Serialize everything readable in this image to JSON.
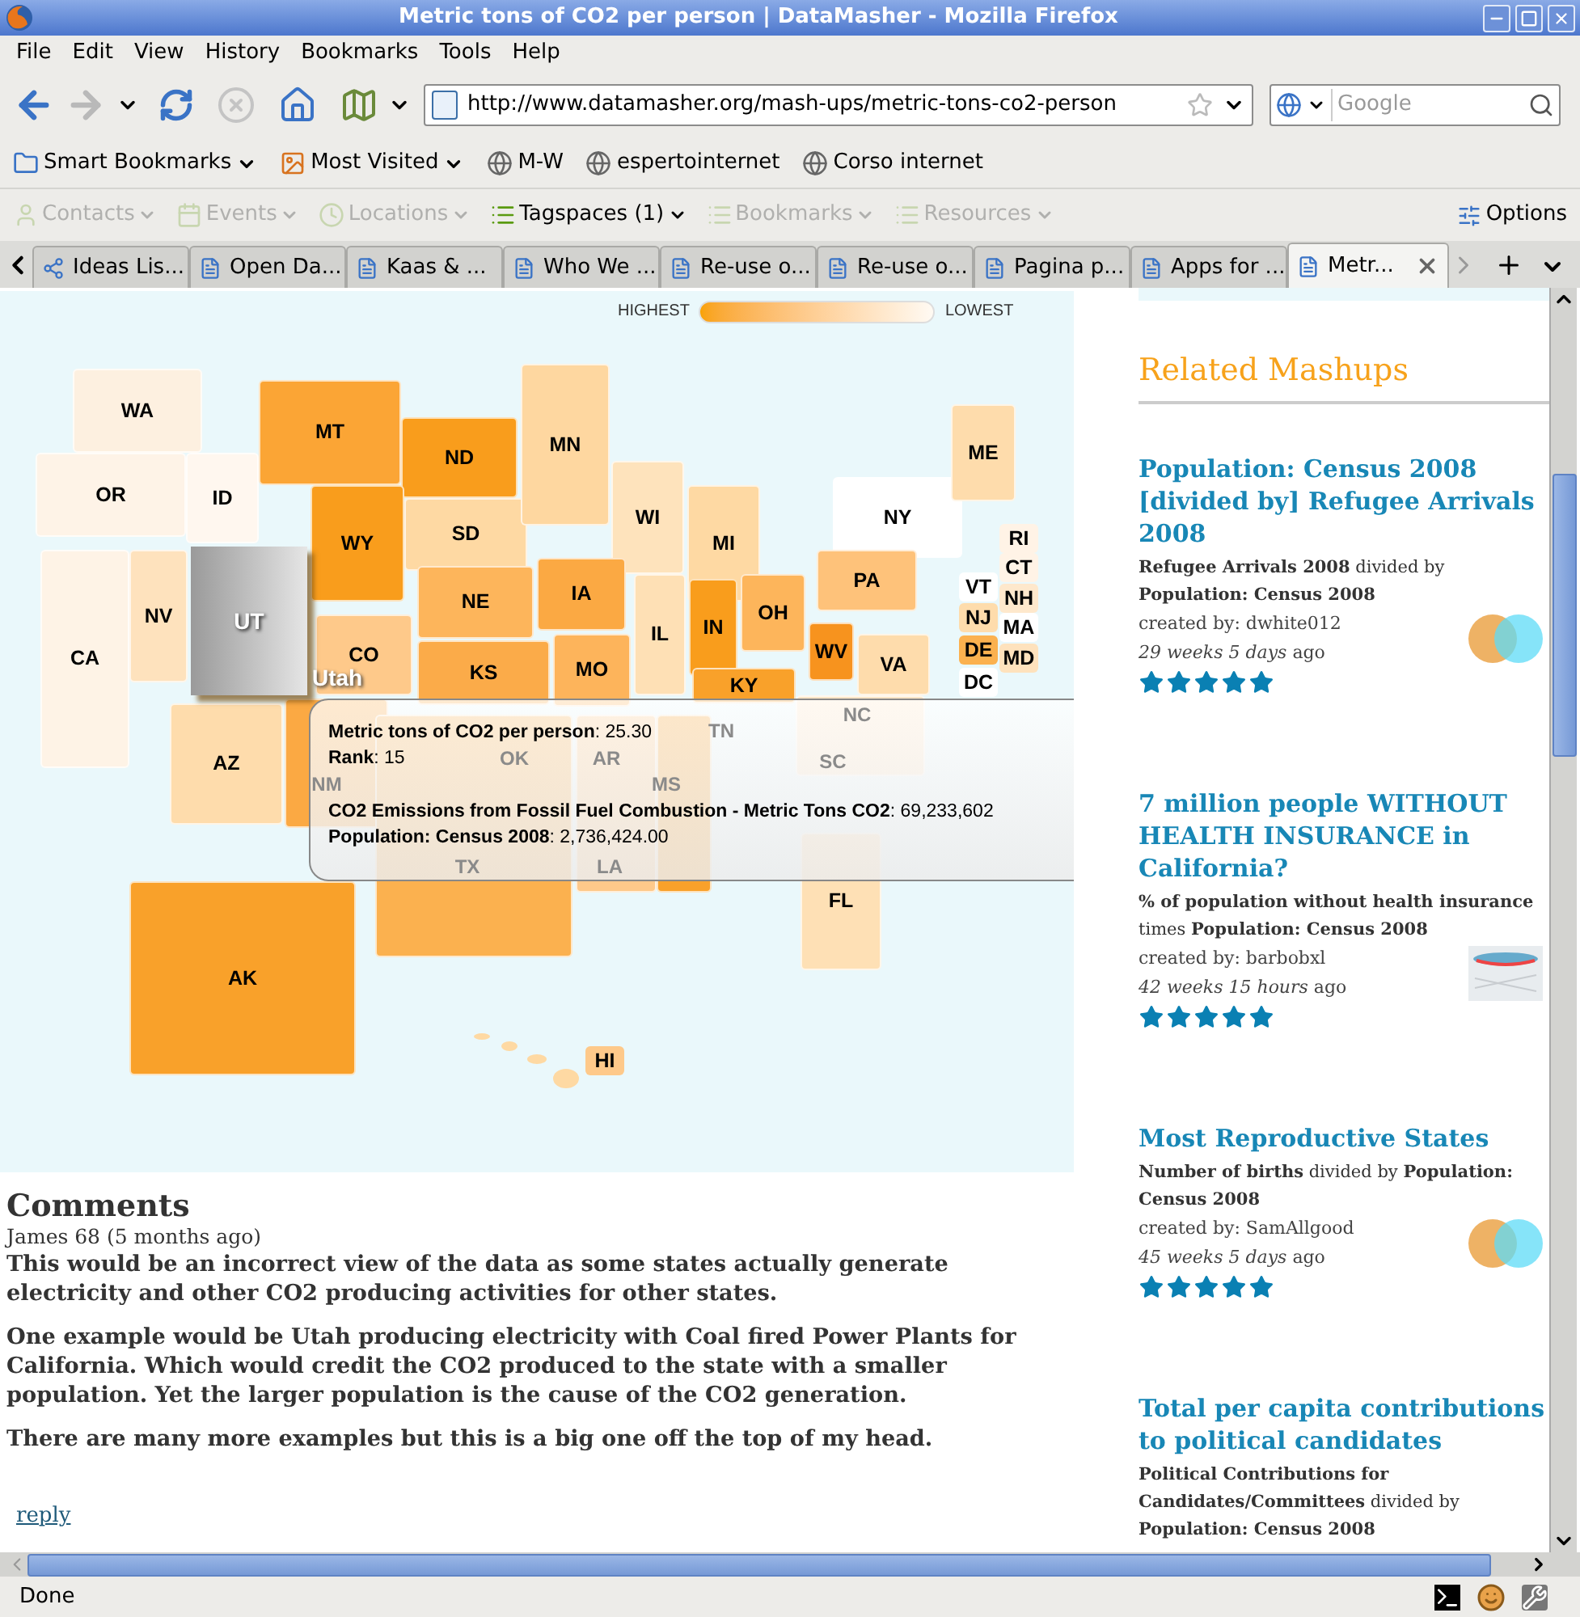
{
  "window": {
    "title": "Metric tons of CO2 per person | DataMasher - Mozilla Firefox"
  },
  "menu": [
    "File",
    "Edit",
    "View",
    "History",
    "Bookmarks",
    "Tools",
    "Help"
  ],
  "address_bar": {
    "url": "http://www.datamasher.org/mash-ups/metric-tons-co2-person"
  },
  "search": {
    "placeholder": "Google"
  },
  "bookmarks": [
    {
      "label": "Smart Bookmarks",
      "kind": "folder"
    },
    {
      "label": "Most Visited",
      "kind": "folder"
    },
    {
      "label": "M-W",
      "kind": "link"
    },
    {
      "label": "espertointernet",
      "kind": "link"
    },
    {
      "label": "Corso internet",
      "kind": "link"
    }
  ],
  "tag_toolbar": {
    "items": [
      {
        "label": "Contacts",
        "disabled": true
      },
      {
        "label": "Events",
        "disabled": true
      },
      {
        "label": "Locations",
        "disabled": true
      },
      {
        "label": "Tagspaces (1)",
        "disabled": false
      },
      {
        "label": "Bookmarks",
        "disabled": true
      },
      {
        "label": "Resources",
        "disabled": true
      }
    ],
    "options": "Options"
  },
  "tabs": [
    {
      "label": "Ideas Lis...",
      "selected": false
    },
    {
      "label": "Open Da...",
      "selected": false
    },
    {
      "label": "Kaas & ...",
      "selected": false
    },
    {
      "label": "Who We ...",
      "selected": false
    },
    {
      "label": "Re-use o...",
      "selected": false
    },
    {
      "label": "Re-use o...",
      "selected": false
    },
    {
      "label": "Pagina p...",
      "selected": false
    },
    {
      "label": "Apps for ...",
      "selected": false
    },
    {
      "label": "Metr...",
      "selected": true
    }
  ],
  "map": {
    "legend": {
      "high": "HIGHEST",
      "low": "LOWEST"
    },
    "states": [
      {
        "label": "WA",
        "color": "#fdf0e0",
        "kind": "region",
        "selected": false
      },
      {
        "label": "OR",
        "color": "#fef3e7",
        "kind": "region",
        "selected": false
      },
      {
        "label": "ID",
        "color": "#fff7ef",
        "kind": "region",
        "selected": false
      },
      {
        "label": "MT",
        "color": "#fba535",
        "kind": "region",
        "selected": false
      },
      {
        "label": "ND",
        "color": "#f99d1c",
        "kind": "region",
        "selected": false
      },
      {
        "label": "WY",
        "color": "#f99d1c",
        "kind": "region",
        "selected": false
      },
      {
        "label": "SD",
        "color": "#fed9a3",
        "kind": "region",
        "selected": false
      },
      {
        "label": "MN",
        "color": "#fed7a0",
        "kind": "region",
        "selected": false
      },
      {
        "label": "WI",
        "color": "#fee3bc",
        "kind": "region",
        "selected": false
      },
      {
        "label": "MI",
        "color": "#fed9a3",
        "kind": "region",
        "selected": false
      },
      {
        "label": "NY",
        "color": "#ffffff",
        "kind": "region",
        "selected": false
      },
      {
        "label": "ME",
        "color": "#fedcac",
        "kind": "region",
        "selected": false
      },
      {
        "label": "CA",
        "color": "#fef3e6",
        "kind": "region",
        "selected": false
      },
      {
        "label": "NV",
        "color": "#fee2bd",
        "kind": "region",
        "selected": false
      },
      {
        "label": "UT",
        "kind": "region",
        "selected": true
      },
      {
        "label": "CO",
        "color": "#fec98a",
        "kind": "region",
        "selected": false
      },
      {
        "label": "NE",
        "color": "#fdb55b",
        "kind": "region",
        "selected": false
      },
      {
        "label": "IA",
        "color": "#fba943",
        "kind": "region",
        "selected": false
      },
      {
        "label": "IL",
        "color": "#fee0b5",
        "kind": "region",
        "selected": false
      },
      {
        "label": "IN",
        "color": "#f99d1c",
        "kind": "region",
        "selected": false
      },
      {
        "label": "OH",
        "color": "#fdb55b",
        "kind": "region",
        "selected": false
      },
      {
        "label": "PA",
        "color": "#fec27a",
        "kind": "region",
        "selected": false
      },
      {
        "label": "WV",
        "color": "#f7931e",
        "kind": "region",
        "selected": false
      },
      {
        "label": "VA",
        "color": "#fedcac",
        "kind": "region",
        "selected": false
      },
      {
        "label": "KS",
        "color": "#fbab49",
        "kind": "region",
        "selected": false
      },
      {
        "label": "MO",
        "color": "#fdb45b",
        "kind": "region",
        "selected": false
      },
      {
        "label": "KY",
        "color": "#f9a12a",
        "kind": "region",
        "selected": false
      },
      {
        "label": "AZ",
        "color": "#fedcac",
        "kind": "region",
        "selected": false
      },
      {
        "label": "NM",
        "color": "#fba943",
        "kind": "covered",
        "selected": false
      },
      {
        "label": "OK",
        "kind": "covered",
        "selected": false
      },
      {
        "label": "TX",
        "color": "#fbb14f",
        "kind": "covered",
        "selected": false
      },
      {
        "label": "AR",
        "kind": "covered",
        "selected": false
      },
      {
        "label": "TN",
        "kind": "covered",
        "selected": false
      },
      {
        "label": "NC",
        "color": "#fee6c8",
        "kind": "covered",
        "selected": false
      },
      {
        "label": "SC",
        "kind": "covered",
        "selected": false
      },
      {
        "label": "MS",
        "color": "#f9a12a",
        "kind": "covered",
        "selected": false
      },
      {
        "label": "LA",
        "color": "#fec98a",
        "kind": "covered",
        "selected": false
      },
      {
        "label": "FL",
        "color": "#fee0b5",
        "kind": "region",
        "selected": false
      },
      {
        "label": "AK",
        "color": "#f9a12a",
        "kind": "region",
        "selected": false
      },
      {
        "label": "HI",
        "color": "#fec98a",
        "kind": "chip",
        "selected": false
      },
      {
        "label": "RI",
        "color": "#fff3e6",
        "kind": "chip",
        "selected": false
      },
      {
        "label": "CT",
        "color": "#fff3e6",
        "kind": "chip",
        "selected": false
      },
      {
        "label": "VT",
        "color": "#ffffff",
        "kind": "chip",
        "selected": false
      },
      {
        "label": "NH",
        "color": "#fee8cc",
        "kind": "chip",
        "selected": false
      },
      {
        "label": "NJ",
        "color": "#fedcac",
        "kind": "chip",
        "selected": false
      },
      {
        "label": "MA",
        "color": "#ffffff",
        "kind": "chip",
        "selected": false
      },
      {
        "label": "DE",
        "color": "#fbb14f",
        "kind": "chip",
        "selected": false
      },
      {
        "label": "MD",
        "color": "#fee2bd",
        "kind": "chip",
        "selected": false
      },
      {
        "label": "DC",
        "color": "#ffffff",
        "kind": "chip",
        "selected": false
      }
    ],
    "hover_label": "Utah",
    "tooltip": {
      "groups": [
        [
          "**Metric tons of CO2 per person**: 25.30",
          "**Rank**: 15"
        ],
        [
          "**CO2 Emissions from Fossil Fuel Combustion - Metric Tons CO2**: 69,233,602",
          "**Population: Census 2008**: 2,736,424.00"
        ]
      ]
    }
  },
  "comments": {
    "heading": "Comments",
    "items": [
      {
        "author": "James 68 (5 months ago)",
        "paragraphs": [
          "This would be an incorrect view of the data as some states actually generate electricity and other CO2 producing activities for other states.",
          "One example would be Utah producing electricity with Coal fired Power Plants for California. Which would credit the CO2 produced to the state with a smaller population. Yet the larger population is the cause of the CO2 generation.",
          "There are many more examples but this is a big one off the top of my head."
        ],
        "reply": "reply"
      }
    ]
  },
  "related": {
    "heading": "Related Mashups",
    "items": [
      {
        "title": "Population: Census 2008 [divided by] Refugee Arrivals 2008",
        "description": "**Refugee Arrivals 2008** divided by **Population: Census 2008**",
        "created_by": "created by: dwhite012",
        "age": "*29 weeks 5 days* ago",
        "stars": 5,
        "kind": "venn"
      },
      {
        "title": "7 million people WITHOUT HEALTH INSURANCE in California?",
        "description": "**% of population without health insurance** times **Population: Census 2008**",
        "created_by": "created by: barbobxl",
        "age": "*42 weeks 15 hours* ago",
        "stars": 5,
        "kind": "chart"
      },
      {
        "title": "Most Reproductive States",
        "description": "**Number of births** divided by **Population: Census 2008**",
        "created_by": "created by: SamAllgood",
        "age": "*45 weeks 5 days* ago",
        "stars": 5,
        "kind": "venn"
      },
      {
        "title": "Total per capita contributions to political candidates",
        "description": "**Political Contributions for Candidates/Committees** divided by **Population: Census 2008**",
        "kind": "plain"
      }
    ]
  },
  "status_bar": {
    "text": "Done"
  }
}
